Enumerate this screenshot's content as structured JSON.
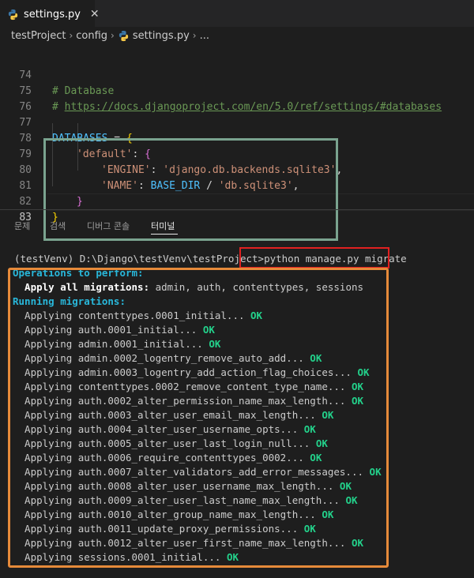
{
  "tab": {
    "title": "settings.py",
    "close": "✕",
    "icon": "python-icon"
  },
  "breadcrumb": {
    "items": [
      "testProject",
      "config",
      "settings.py",
      "..."
    ],
    "separator": "›"
  },
  "editor": {
    "line_numbers": [
      "74",
      "75",
      "76",
      "77",
      "78",
      "79",
      "80",
      "81",
      "82",
      "83"
    ],
    "comment_database": "# Database",
    "comment_hash": "# ",
    "link": "https://docs.djangoproject.com/en/5.0/ref/settings/#databases",
    "databases_var": "DATABASES",
    "equals": " = ",
    "open_brace": "{",
    "default_key": "'default'",
    "colon": ": ",
    "engine_key": "'ENGINE'",
    "engine_val": "'django.db.backends.sqlite3'",
    "comma": ",",
    "name_key": "'NAME'",
    "base_dir": "BASE_DIR",
    "slash": " / ",
    "db_file": "'db.sqlite3'",
    "close_brace_inner": "}",
    "close_brace_outer": "}"
  },
  "panel": {
    "tabs": [
      "문제",
      "검색",
      "디버그 콘솔",
      "터미널"
    ],
    "active_tab": "터미널"
  },
  "terminal": {
    "prompt": "(testVenv) D:\\Django\\testVenv\\testProject>",
    "command": "python manage.py migrate",
    "ops_header": "Operations to perform:",
    "apply_label": "  Apply all migrations:",
    "apply_list": " admin, auth, contenttypes, sessions",
    "running_header": "Running migrations:",
    "ok_label": "OK",
    "migrations": [
      "  Applying contenttypes.0001_initial... ",
      "  Applying auth.0001_initial... ",
      "  Applying admin.0001_initial... ",
      "  Applying admin.0002_logentry_remove_auto_add... ",
      "  Applying admin.0003_logentry_add_action_flag_choices... ",
      "  Applying contenttypes.0002_remove_content_type_name... ",
      "  Applying auth.0002_alter_permission_name_max_length... ",
      "  Applying auth.0003_alter_user_email_max_length... ",
      "  Applying auth.0004_alter_user_username_opts... ",
      "  Applying auth.0005_alter_user_last_login_null... ",
      "  Applying auth.0006_require_contenttypes_0002... ",
      "  Applying auth.0007_alter_validators_add_error_messages... ",
      "  Applying auth.0008_alter_user_username_max_length... ",
      "  Applying auth.0009_alter_user_last_name_max_length... ",
      "  Applying auth.0010_alter_group_name_max_length... ",
      "  Applying auth.0011_update_proxy_permissions... ",
      "  Applying auth.0012_alter_user_first_name_max_length... ",
      "  Applying sessions.0001_initial... "
    ]
  },
  "colors": {
    "accent_green_box": "#7aa38f",
    "accent_red_box": "#e02020",
    "accent_orange_box": "#e68a3a",
    "ok_green": "#23d18b",
    "cyan_header": "#29b8db"
  }
}
